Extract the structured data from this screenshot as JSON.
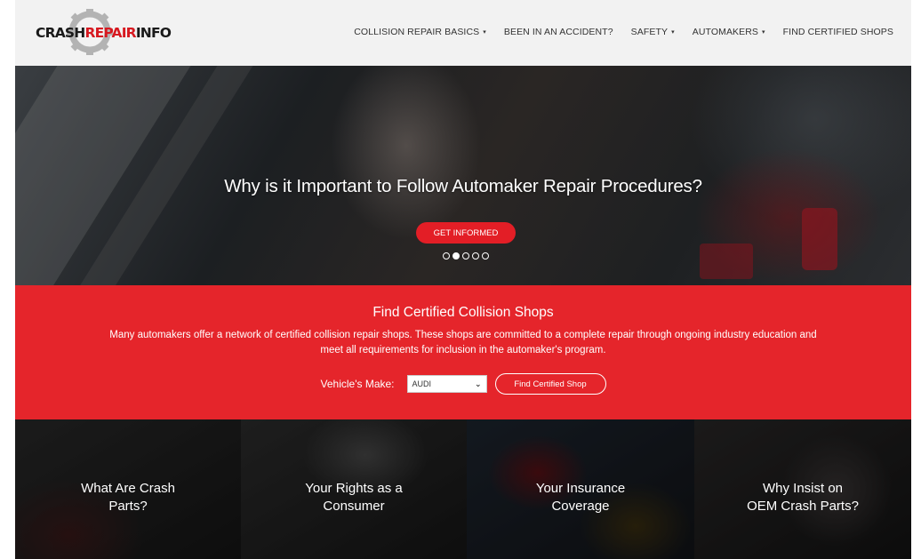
{
  "brand": {
    "logo_crash": "CRASH",
    "logo_repair": "REPAIR",
    "logo_info": "INFO",
    "colors": {
      "primary_red": "#e5252b",
      "button_red": "#e31e26",
      "header_bg": "#f2f2f2"
    }
  },
  "nav": {
    "items": [
      {
        "label": "COLLISION REPAIR BASICS",
        "dropdown": "▾"
      },
      {
        "label": "BEEN IN AN ACCIDENT?"
      },
      {
        "label": "SAFETY",
        "dropdown": "▾"
      },
      {
        "label": "AUTOMAKERS",
        "dropdown": "▾"
      },
      {
        "label": "FIND CERTIFIED SHOPS"
      }
    ]
  },
  "hero": {
    "title": "Why is it Important to Follow Automaker Repair Procedures?",
    "button": "GET INFORMED",
    "slides": 5,
    "active_slide": 2
  },
  "finder": {
    "title": "Find Certified Collision Shops",
    "description": "Many automakers offer a network of certified collision repair shops. These shops are committed to a complete repair through ongoing industry education and meet all requirements for inclusion in the automaker's program.",
    "make_label": "Vehicle's Make:",
    "make_value": "AUDI",
    "button": "Find Certified Shop"
  },
  "tiles": [
    {
      "line1": "What Are Crash",
      "line2": "Parts?"
    },
    {
      "line1": "Your Rights as a",
      "line2": "Consumer"
    },
    {
      "line1": "Your Insurance",
      "line2": "Coverage"
    },
    {
      "line1": "Why Insist on",
      "line2": "OEM Crash Parts?"
    }
  ]
}
